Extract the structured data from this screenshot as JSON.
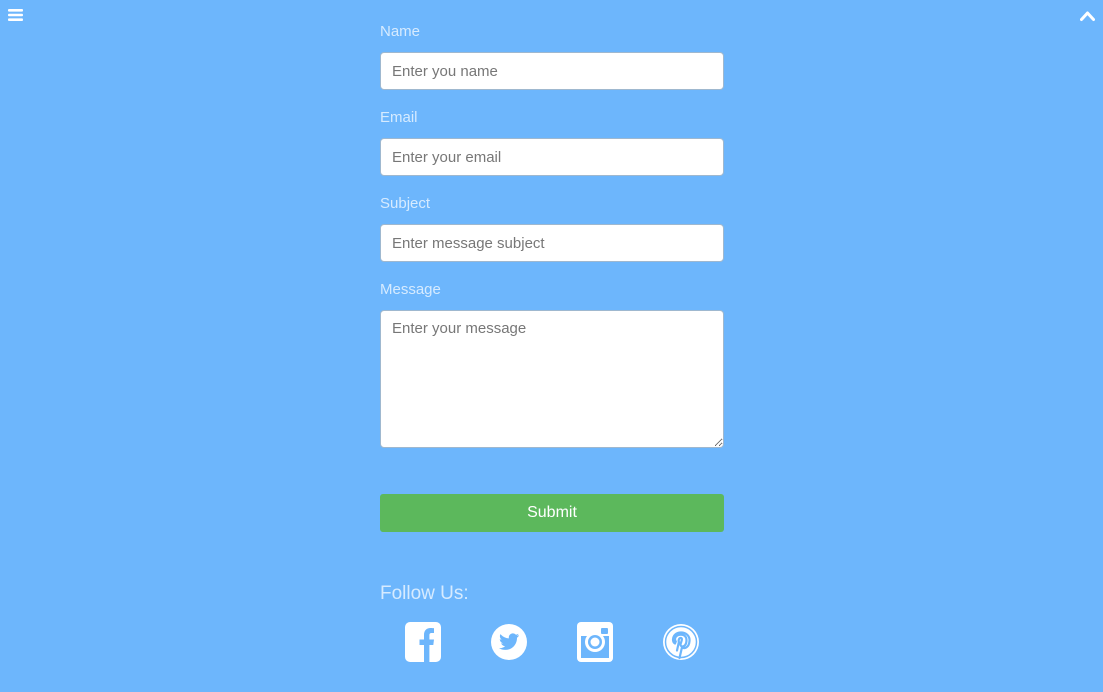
{
  "header": {
    "menu_icon": "hamburger-menu-icon",
    "scroll_top_icon": "chevron-up-icon"
  },
  "form": {
    "name": {
      "label": "Name",
      "placeholder": "Enter you name",
      "value": ""
    },
    "email": {
      "label": "Email",
      "placeholder": "Enter your email",
      "value": ""
    },
    "subject": {
      "label": "Subject",
      "placeholder": "Enter message subject",
      "value": ""
    },
    "message": {
      "label": "Message",
      "placeholder": "Enter your message",
      "value": ""
    },
    "submit_label": "Submit"
  },
  "social": {
    "title": "Follow Us:",
    "icons": [
      "facebook-icon",
      "twitter-icon",
      "instagram-icon",
      "pinterest-icon"
    ]
  },
  "colors": {
    "background": "#6db6fc",
    "label_text": "#d6ebff",
    "submit_button": "#5cb85c",
    "icon": "#ffffff"
  }
}
